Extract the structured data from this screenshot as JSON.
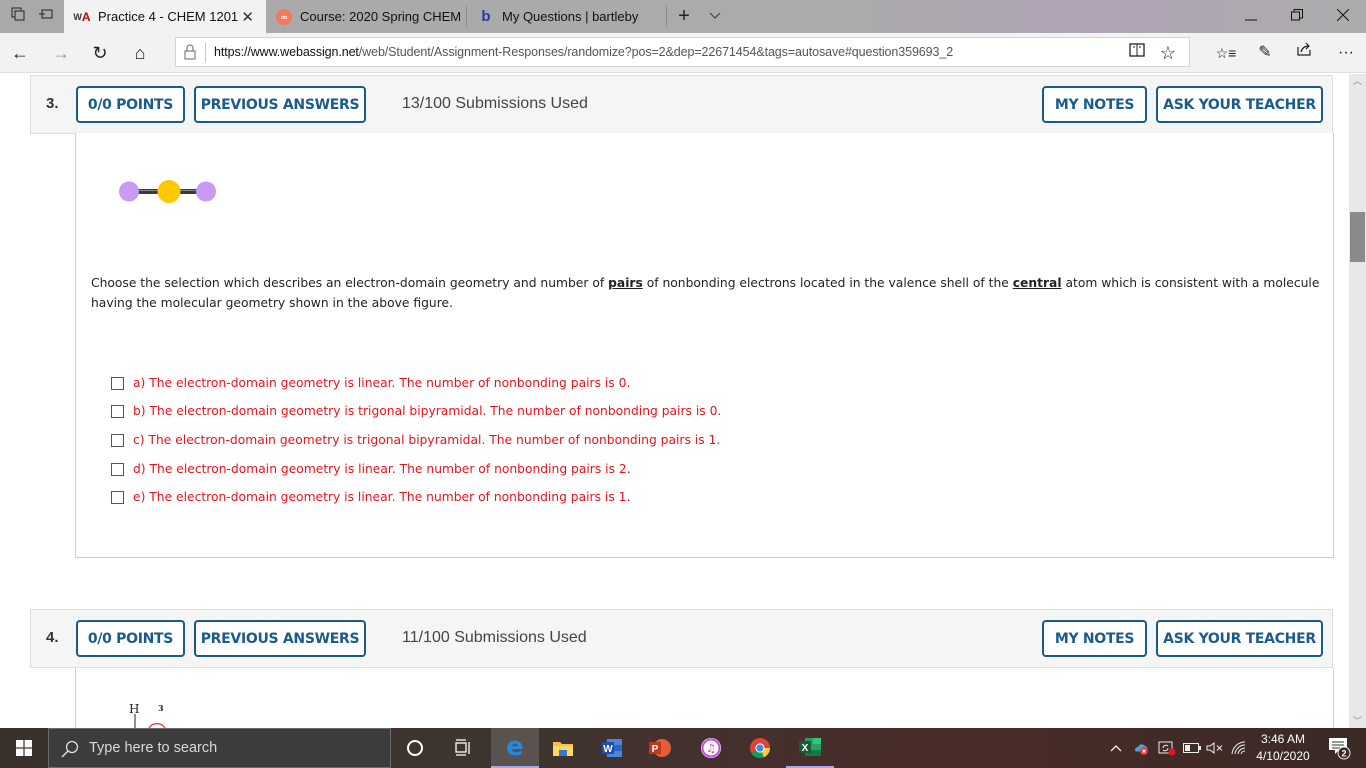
{
  "browser": {
    "tabs": [
      {
        "label": "Practice 4 - CHEM 1201",
        "favicon": "webassign-icon",
        "active": true
      },
      {
        "label": "Course: 2020 Spring CHEM",
        "favicon": "course-icon",
        "active": false
      },
      {
        "label": "My Questions | bartleby",
        "favicon": "bartleby-icon",
        "active": false
      }
    ],
    "url_domain": "https://www.webassign.net",
    "url_path": "/web/Student/Assignment-Responses/randomize?pos=2&dep=22671454&tags=autosave#question359693_2",
    "icons": {
      "tab_actions": "⧉",
      "back": "←",
      "forward": "→",
      "refresh": "↻",
      "home": "⌂",
      "new_tab": "+",
      "tab_menu": "⌵",
      "minimize": "—",
      "restore": "❐",
      "close": "✕",
      "reading_view": "▯",
      "favorite": "☆",
      "favorites_list": "☆≡",
      "notes": "✎",
      "share": "⇪",
      "more": "···"
    }
  },
  "questions": [
    {
      "number": "3.",
      "points_label": "0/0 POINTS",
      "previous_answers_label": "PREVIOUS ANSWERS",
      "submissions": "13/100 Submissions Used",
      "my_notes_label": "MY NOTES",
      "ask_teacher_label": "ASK YOUR TEACHER",
      "prompt_part1": "Choose the selection which describes an electron-domain geometry and number of ",
      "prompt_bold1": "pairs",
      "prompt_part2": " of nonbonding electrons located in the valence shell of the ",
      "prompt_bold2": "central",
      "prompt_part3": " atom which is consistent with a molecule having the molecular geometry shown in the above figure.",
      "molecule_colors": {
        "outer": "#c89af2",
        "central": "#ffc800",
        "bond": "#3a3a3a"
      },
      "choices": [
        {
          "label": "a) The electron-domain geometry is linear. The number of nonbonding pairs is 0.",
          "checked": false
        },
        {
          "label": "b) The electron-domain geometry is trigonal bipyramidal. The number of nonbonding pairs is 0.",
          "checked": false
        },
        {
          "label": "c) The electron-domain geometry is trigonal bipyramidal. The number of nonbonding pairs is 1.",
          "checked": false
        },
        {
          "label": "d) The electron-domain geometry is linear. The number of nonbonding pairs is 2.",
          "checked": false
        },
        {
          "label": "e) The electron-domain geometry is linear. The number of nonbonding pairs is 1.",
          "checked": false
        }
      ]
    },
    {
      "number": "4.",
      "points_label": "0/0 POINTS",
      "previous_answers_label": "PREVIOUS ANSWERS",
      "submissions": "11/100 Submissions Used",
      "my_notes_label": "MY NOTES",
      "ask_teacher_label": "ASK YOUR TEACHER",
      "figure_atom": "H",
      "figure_label": "3"
    }
  ],
  "colors": {
    "button_border": "#1a5b8c",
    "choice_text": "#e8141c"
  },
  "taskbar": {
    "search_placeholder": "Type here to search",
    "apps": [
      "cortana",
      "task-view",
      "edge",
      "file-explorer",
      "word",
      "powerpoint",
      "itunes",
      "chrome",
      "excel"
    ],
    "time": "3:46 AM",
    "date": "4/10/2020",
    "notification_count": "2"
  }
}
